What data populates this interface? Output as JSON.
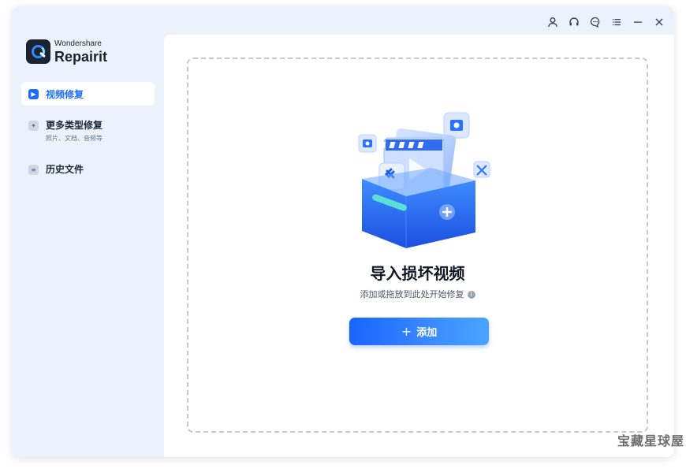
{
  "app": {
    "brand_small": "Wondershare",
    "brand_name": "Repairit"
  },
  "sidebar": {
    "items": [
      {
        "label": "视频修复",
        "sub": "",
        "icon": "play-icon",
        "active": true
      },
      {
        "label": "更多类型修复",
        "sub": "照片、文档、音频等",
        "icon": "wrench-icon",
        "active": false
      },
      {
        "label": "历史文件",
        "sub": "",
        "icon": "document-icon",
        "active": false
      }
    ]
  },
  "topbar": {
    "icons": [
      "user-icon",
      "headset-icon",
      "chat-icon",
      "menu-icon",
      "minimize-icon",
      "close-icon"
    ]
  },
  "dropzone": {
    "title": "导入损坏视频",
    "subtitle": "添加或拖放到此处开始修复",
    "add_label": "添加"
  },
  "watermark": "宝藏星球屋",
  "colors": {
    "accent": "#1a6dff",
    "sidebar_bg": "#ebf2fb",
    "button_start": "#1a64ff",
    "button_end": "#49a5ff"
  }
}
